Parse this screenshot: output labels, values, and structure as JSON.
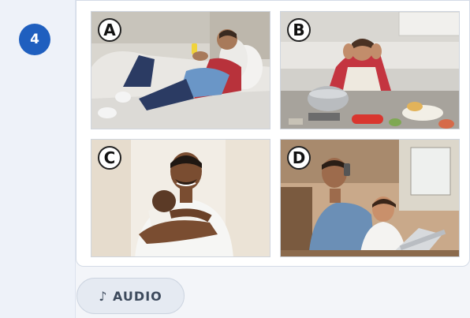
{
  "question": {
    "number": "4"
  },
  "options": [
    {
      "letter": "A",
      "scene": "man lying on sofa looking at phone"
    },
    {
      "letter": "B",
      "scene": "stressed man in messy kitchen"
    },
    {
      "letter": "C",
      "scene": "smiling man holding baby"
    },
    {
      "letter": "D",
      "scene": "man on phone with toddler at laptop"
    }
  ],
  "audio": {
    "icon": "music-note-icon",
    "label": "♪ AUDIO"
  },
  "colors": {
    "accent": "#1f5fbf",
    "rail": "#eef2f9",
    "button": "#e5eaf2"
  }
}
